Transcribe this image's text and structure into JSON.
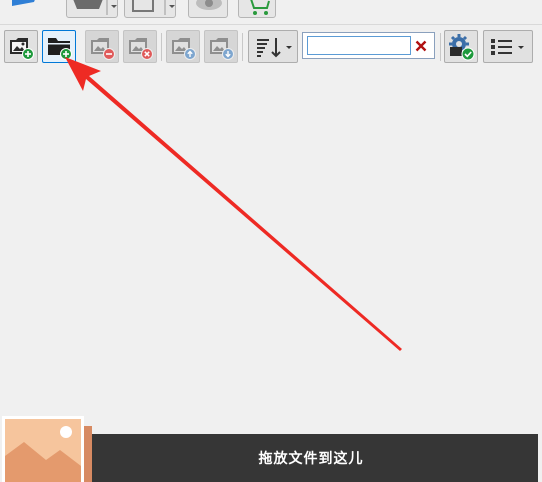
{
  "top_toolbar": {
    "items": [
      {
        "icon": "play-icon"
      },
      {
        "icon": "shirt-dropdown-icon"
      },
      {
        "icon": "save-dropdown-icon"
      },
      {
        "icon": "eye-icon"
      },
      {
        "icon": "cart-icon"
      }
    ]
  },
  "toolbar": {
    "buttons": [
      {
        "icon": "add-image-icon",
        "state": "enabled"
      },
      {
        "icon": "add-folder-icon",
        "state": "active"
      },
      {
        "icon": "remove-image-icon",
        "state": "disabled"
      },
      {
        "icon": "delete-image-icon",
        "state": "disabled"
      },
      {
        "icon": "move-up-image-icon",
        "state": "disabled"
      },
      {
        "icon": "move-down-image-icon",
        "state": "disabled"
      },
      {
        "icon": "sort-dropdown-icon",
        "state": "enabled"
      },
      {
        "icon": "settings-check-icon",
        "state": "enabled"
      },
      {
        "icon": "list-view-dropdown-icon",
        "state": "enabled"
      }
    ],
    "search": {
      "value": "",
      "placeholder": ""
    }
  },
  "drop_zone": {
    "label": "拖放文件到这儿"
  },
  "colors": {
    "background": "#f0f0f0",
    "active_border": "#0078d7",
    "drop_bar": "#363636",
    "annotation_arrow": "#ee2a24",
    "plus_badge": "#1e9a3c",
    "minus_badge": "#e05a5a",
    "clear_x": "#b01010"
  }
}
